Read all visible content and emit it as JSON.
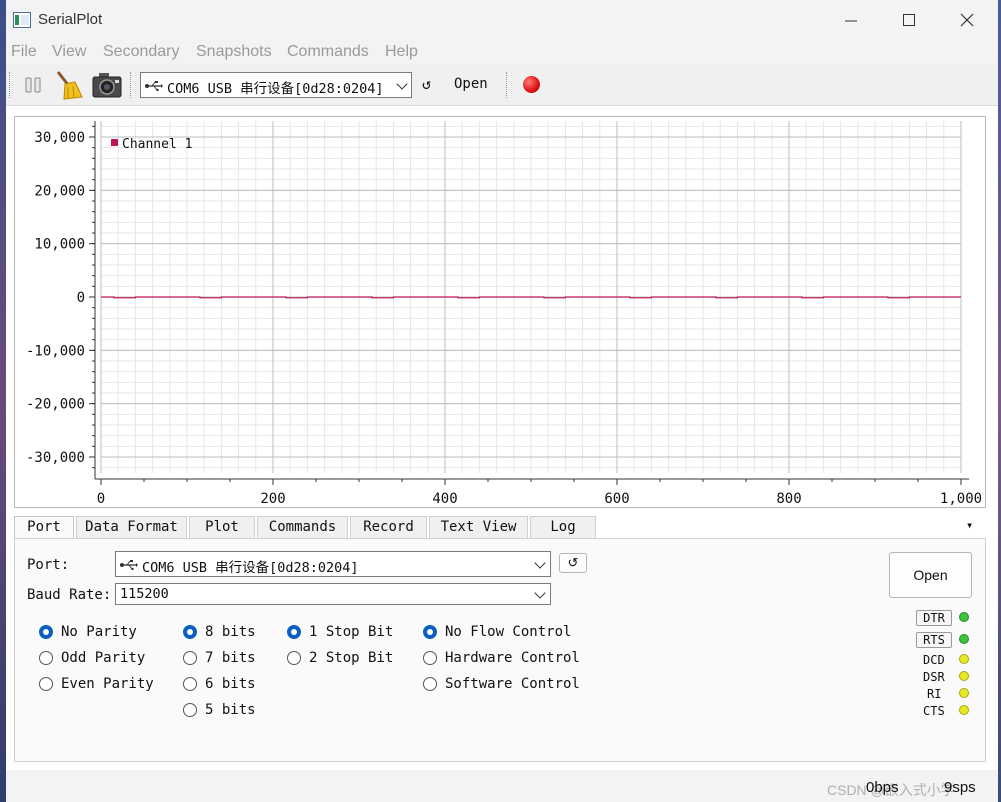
{
  "window": {
    "title": "SerialPlot",
    "titlebar_bg": "#f3f3f3"
  },
  "menu": {
    "items": [
      "File",
      "View",
      "Secondary",
      "Snapshots",
      "Commands",
      "Help"
    ]
  },
  "toolbar": {
    "port_combo": "COM6 USB 串行设备[0d28:0204]",
    "refresh_glyph": "↺",
    "open_label": "Open",
    "record_color": "#e01818"
  },
  "plot": {
    "legend_label": "Channel 1",
    "line_color": "#c0145a"
  },
  "chart_data": {
    "type": "line",
    "title": "",
    "xlabel": "",
    "ylabel": "",
    "xlim": [
      0,
      1000
    ],
    "ylim": [
      -33000,
      33000
    ],
    "x_ticks": [
      0,
      200,
      400,
      600,
      800,
      1000
    ],
    "x_tick_labels": [
      "0",
      "200",
      "400",
      "600",
      "800",
      "1,000"
    ],
    "y_ticks": [
      30000,
      20000,
      10000,
      0,
      -10000,
      -20000,
      -30000
    ],
    "y_tick_labels": [
      "30,000",
      "20,000",
      "10,000",
      "0",
      "-10,000",
      "-20,000",
      "-30,000"
    ],
    "grid": true,
    "legend": "top-left",
    "series": [
      {
        "name": "Channel 1",
        "color": "#c0145a",
        "x": [
          0,
          15,
          15,
          40,
          40,
          115,
          115,
          140,
          140,
          215,
          215,
          240,
          240,
          315,
          315,
          340,
          340,
          415,
          415,
          440,
          440,
          515,
          515,
          540,
          540,
          615,
          615,
          640,
          640,
          715,
          715,
          740,
          740,
          815,
          815,
          840,
          840,
          915,
          915,
          940,
          940,
          1000
        ],
        "y": [
          0,
          0,
          -150,
          -150,
          0,
          0,
          -150,
          -150,
          0,
          0,
          -150,
          -150,
          0,
          0,
          -150,
          -150,
          0,
          0,
          -150,
          -150,
          0,
          0,
          -150,
          -150,
          0,
          0,
          -150,
          -150,
          0,
          0,
          -150,
          -150,
          0,
          0,
          -150,
          -150,
          0,
          0,
          -150,
          -150,
          0,
          0
        ]
      }
    ]
  },
  "tabs": [
    "Port",
    "Data Format",
    "Plot",
    "Commands",
    "Record",
    "Text View",
    "Log"
  ],
  "tab_overflow": "▾",
  "port_panel": {
    "port_label": "Port:",
    "port_value": "COM6 USB 串行设备[0d28:0204]",
    "refresh_glyph": "↺",
    "baud_label": "Baud Rate:",
    "baud_value": "115200",
    "open_label": "Open",
    "parity": [
      "No Parity",
      "Odd Parity",
      "Even Parity"
    ],
    "parity_selected": "No Parity",
    "data_bits": [
      "8 bits",
      "7 bits",
      "6 bits",
      "5 bits"
    ],
    "data_bits_selected": "8 bits",
    "stop_bits": [
      "1 Stop Bit",
      "2 Stop Bit"
    ],
    "stop_bits_selected": "1 Stop Bit",
    "flow": [
      "No Flow Control",
      "Hardware Control",
      "Software Control"
    ],
    "flow_selected": "No Flow Control",
    "pins": {
      "dtr": "DTR",
      "rts": "RTS",
      "dcd": "DCD",
      "dsr": "DSR",
      "ri": "RI",
      "cts": "CTS"
    },
    "led_green": "#3cc43c",
    "led_yellow": "#e8e820"
  },
  "status": {
    "bps": "0bps",
    "sps": "9sps",
    "watermark": "CSDN @嵌入式小学"
  }
}
